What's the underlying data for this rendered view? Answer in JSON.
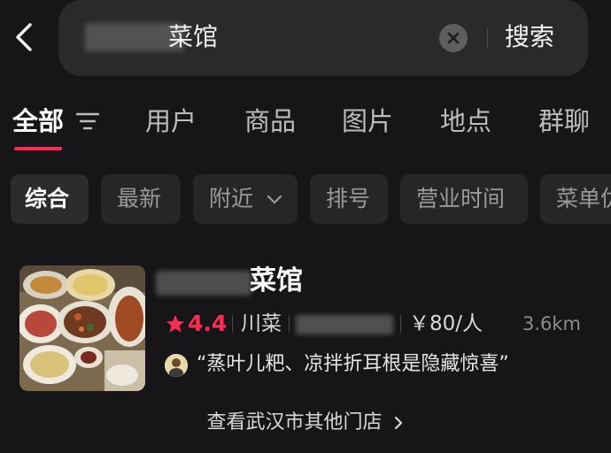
{
  "search": {
    "query_visible": "菜馆",
    "button_label": "搜索"
  },
  "tabs": [
    {
      "label": "全部",
      "active": true
    },
    {
      "label": "用户"
    },
    {
      "label": "商品"
    },
    {
      "label": "图片"
    },
    {
      "label": "地点"
    },
    {
      "label": "群聊"
    }
  ],
  "filters": [
    {
      "label": "综合",
      "active": true
    },
    {
      "label": "最新"
    },
    {
      "label": "附近"
    },
    {
      "label": "排号"
    },
    {
      "label": "营业时间"
    },
    {
      "label": "菜单优"
    }
  ],
  "result": {
    "name_visible": "菜馆",
    "rating": "4.4",
    "cuisine": "川菜",
    "price": "￥80/人",
    "distance": "3.6km",
    "quote": "“蒸叶儿粑、凉拌折耳根是隐藏惊喜”",
    "more_stores": "查看武汉市其他门店"
  },
  "colors": {
    "accent": "#fe2c55",
    "background": "#161618",
    "chip": "#262628"
  }
}
